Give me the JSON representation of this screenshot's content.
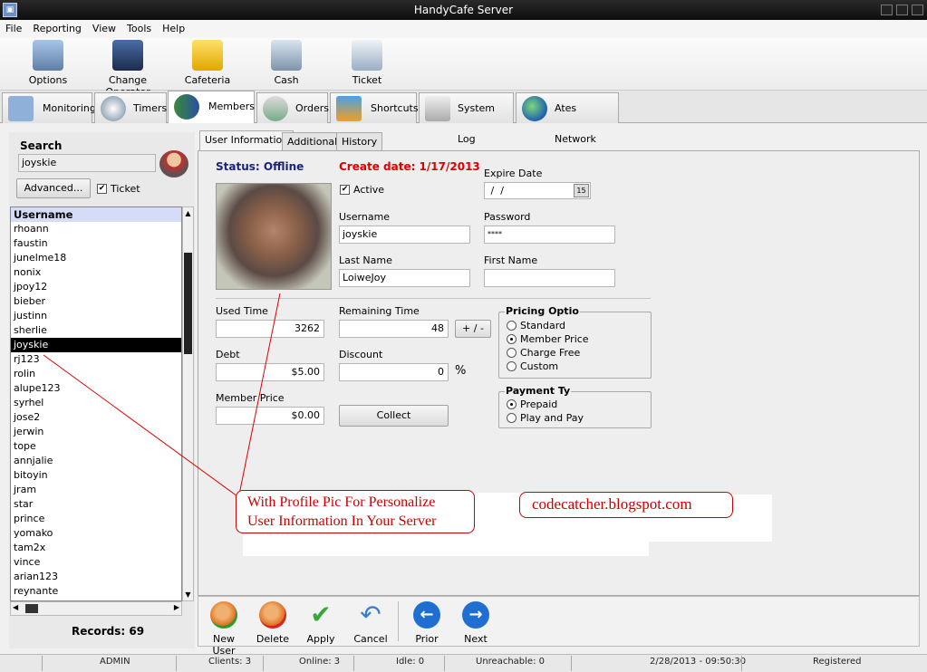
{
  "window": {
    "title": "HandyCafe Server"
  },
  "menu": [
    "File",
    "Reporting",
    "View",
    "Tools",
    "Help"
  ],
  "toolbar": [
    {
      "label": "Options",
      "icon": "monitor-gear-icon"
    },
    {
      "label": "Change Operator",
      "icon": "users-icon"
    },
    {
      "label": "Cafeteria",
      "icon": "shopping-bag-icon"
    },
    {
      "label": "Cash",
      "icon": "cash-register-icon"
    },
    {
      "label": "Ticket",
      "icon": "printer-icon"
    }
  ],
  "main_tabs": [
    {
      "label": "Monitoring",
      "icon": "monitoring-icon"
    },
    {
      "label": "Timers",
      "icon": "timer-icon"
    },
    {
      "label": "Members",
      "icon": "members-icon"
    },
    {
      "label": "Orders",
      "icon": "cart-icon"
    },
    {
      "label": "Shortcuts",
      "icon": "shortcuts-icon"
    },
    {
      "label": "System Log",
      "icon": "scroll-icon"
    },
    {
      "label": "Ates Network",
      "icon": "globe-icon"
    }
  ],
  "search": {
    "title": "Search",
    "value": "joyskie",
    "advanced_label": "Advanced...",
    "ticket_label": "Ticket",
    "ticket_checked": true
  },
  "user_list": {
    "header": "Username",
    "items": [
      "rhoann",
      "faustin",
      "junelme18",
      "nonix",
      "jpoy12",
      "bieber",
      "justinn",
      "sherlie",
      "joyskie",
      "rj123",
      "rolin",
      "alupe123",
      "syrhel",
      "jose2",
      "jerwin",
      "tope",
      "annjalie",
      "bitoyin",
      "jram",
      "star",
      "prince",
      "yomako",
      "tam2x",
      "vince",
      "arian123",
      "reynante"
    ],
    "selected": "joyskie"
  },
  "records": "Records: 69",
  "sub_tabs": [
    "User Information",
    "Additional",
    "History"
  ],
  "user_info": {
    "status": "Status: Offline",
    "create_date": "Create date: 1/17/2013",
    "active_label": "Active",
    "active_checked": true,
    "expire_label": "Expire Date",
    "expire_value": " /  /",
    "username_label": "Username",
    "username_value": "joyskie",
    "password_label": "Password",
    "password_value": "****",
    "lastname_label": "Last Name",
    "lastname_value": "LoiweJoy",
    "firstname_label": "First Name",
    "firstname_value": "",
    "used_time_label": "Used Time",
    "used_time_value": "3262",
    "remaining_time_label": "Remaining Time",
    "remaining_time_value": "48",
    "plus_minus_label": "+ / -",
    "debt_label": "Debt",
    "debt_value": "$5.00",
    "discount_label": "Discount",
    "discount_value": "0",
    "percent": "%",
    "member_price_label": "Member Price",
    "member_price_value": "$0.00",
    "collect_label": "Collect",
    "pricing": {
      "title": "Pricing Optio",
      "options": [
        "Standard",
        "Member Price",
        "Charge Free",
        "Custom"
      ],
      "selected": "Member Price"
    },
    "payment": {
      "title": "Payment Ty",
      "options": [
        "Prepaid",
        "Play and Pay"
      ],
      "selected": "Prepaid"
    }
  },
  "annotations": {
    "line1": "With Profile Pic For Personalize",
    "line2": "User Information In Your Server",
    "site": "codecatcher.blogspot.com"
  },
  "actions": [
    {
      "label": "New User",
      "icon": "add-user-icon",
      "color": "#2c9a2c"
    },
    {
      "label": "Delete",
      "icon": "delete-user-icon",
      "color": "#d22"
    },
    {
      "label": "Apply",
      "icon": "checkmark-icon",
      "color": "#3aa53a"
    },
    {
      "label": "Cancel",
      "icon": "undo-icon",
      "color": "#3a7fd0"
    },
    {
      "label": "Prior",
      "icon": "arrow-left-icon",
      "color": "#1f6fd1"
    },
    {
      "label": "Next",
      "icon": "arrow-right-icon",
      "color": "#1f6fd1"
    }
  ],
  "status_bar": {
    "operator": "ADMIN",
    "clients": "Clients: 3",
    "online": "Online: 3",
    "idle": "Idle: 0",
    "unreachable": "Unreachable: 0",
    "datetime": "2/28/2013 - 09:50:30",
    "registration": "Registered"
  },
  "colors": {
    "accent_red": "#e00000",
    "status_blue": "#1a237e",
    "selected_row": "#000000",
    "list_header": "#d6dcf7"
  }
}
